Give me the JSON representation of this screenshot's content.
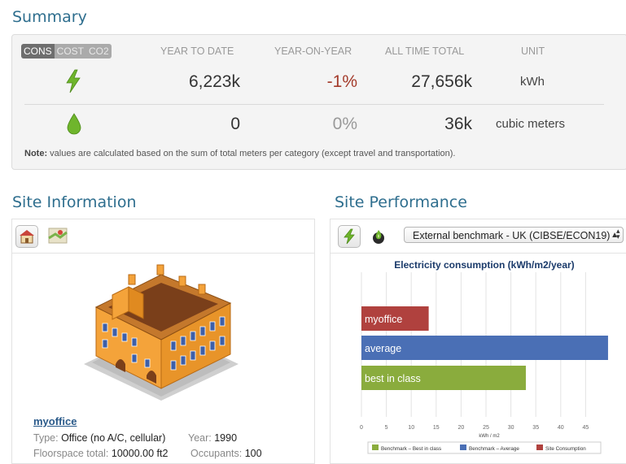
{
  "summary": {
    "title": "Summary",
    "modes": [
      "CONS",
      "COST",
      "CO2"
    ],
    "active_mode": "CONS",
    "columns": [
      "YEAR TO DATE",
      "YEAR-ON-YEAR",
      "ALL TIME TOTAL",
      "UNIT"
    ],
    "rows": [
      {
        "icon": "lightning-icon",
        "ytd": "6,223k",
        "yoy": "-1%",
        "total": "27,656k",
        "unit": "kWh"
      },
      {
        "icon": "water-drop-icon",
        "ytd": "0",
        "yoy": "0%",
        "total": "36k",
        "unit": "cubic meters"
      }
    ],
    "note_label": "Note:",
    "note_text": " values are calculated based on the sum of total meters per category (except travel and transportation)."
  },
  "site_info": {
    "title": "Site Information",
    "site_name": "myoffice",
    "type_label": "Type:",
    "type_value": "Office (no A/C, cellular)",
    "year_label": "Year:",
    "year_value": "1990",
    "floor_label": "Floorspace total:",
    "floor_value": "10000.00 ft2",
    "occ_label": "Occupants:",
    "occ_value": "100"
  },
  "site_performance": {
    "title": "Site Performance",
    "benchmark_select": "External benchmark - UK (CIBSE/ECON19)"
  },
  "colors": {
    "site": "#b0413e",
    "average": "#4a6fb5",
    "best": "#8aac3d",
    "accent": "#2e6e8e"
  },
  "chart_data": {
    "type": "bar",
    "orientation": "horizontal",
    "title": "Electricity consumption (kWh/m2/year)",
    "xlabel": "kWh / m2",
    "categories": [
      "myoffice",
      "average",
      "best in class"
    ],
    "values": [
      13.5,
      49.5,
      33
    ],
    "xlim": [
      0,
      50
    ],
    "xticks": [
      0,
      5,
      10,
      15,
      20,
      25,
      30,
      35,
      40,
      45
    ],
    "grid": true,
    "legend": [
      "Benchmark – Best in class",
      "Benchmark – Average",
      "Site Consumption"
    ],
    "legend_position": "bottom"
  }
}
